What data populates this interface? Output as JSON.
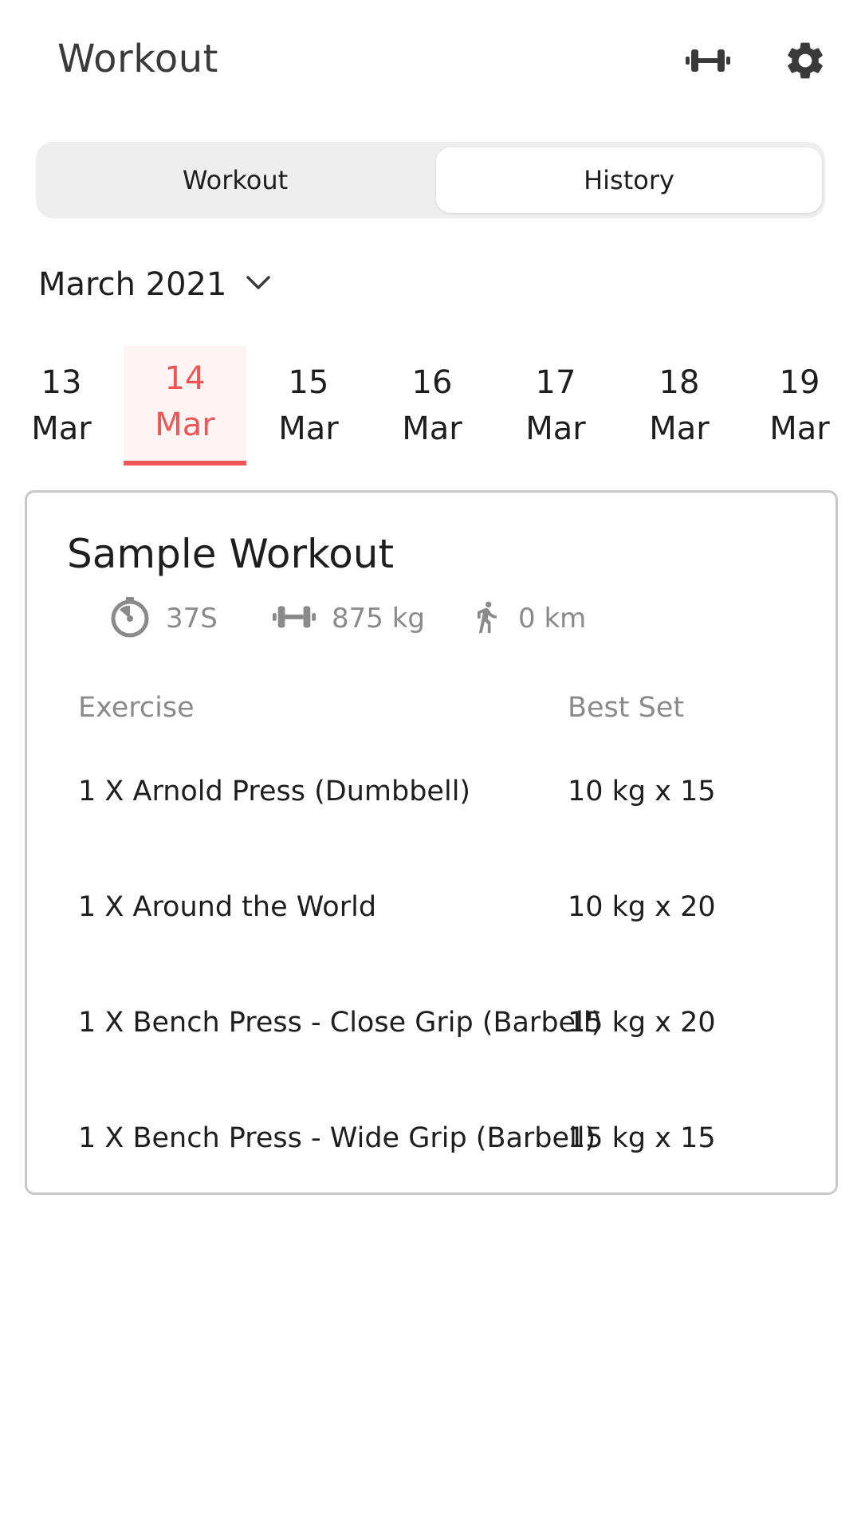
{
  "header": {
    "title": "Workout",
    "icons": [
      "dumbbell-icon",
      "gear-icon"
    ]
  },
  "tabs": [
    {
      "label": "Workout",
      "selected": false
    },
    {
      "label": "History",
      "selected": true
    }
  ],
  "month_selector": {
    "label": "March 2021",
    "icon": "chevron-down-icon"
  },
  "dates": [
    {
      "day": "13",
      "month": "Mar",
      "selected": false
    },
    {
      "day": "14",
      "month": "Mar",
      "selected": true
    },
    {
      "day": "15",
      "month": "Mar",
      "selected": false
    },
    {
      "day": "16",
      "month": "Mar",
      "selected": false
    },
    {
      "day": "17",
      "month": "Mar",
      "selected": false
    },
    {
      "day": "18",
      "month": "Mar",
      "selected": false
    },
    {
      "day": "19",
      "month": "Mar",
      "selected": false
    }
  ],
  "workout_card": {
    "title": "Sample Workout",
    "stats": {
      "duration": "37S",
      "weight": "875 kg",
      "distance": "0 km"
    },
    "columns": {
      "exercise": "Exercise",
      "best_set": "Best Set"
    },
    "exercises": [
      {
        "name": "1 X Arnold Press (Dumbbell)",
        "best_set": "10 kg x 15"
      },
      {
        "name": "1 X Around the World",
        "best_set": "10 kg x 20"
      },
      {
        "name": "1 X Bench Press - Close Grip (Barbell)",
        "best_set": "15 kg x 20"
      },
      {
        "name": "1 X Bench Press - Wide Grip (Barbell)",
        "best_set": "15 kg x 15"
      }
    ]
  },
  "colors": {
    "accent": "#f05454",
    "accent_bg": "#fff4f4",
    "text": "#1e1e1e",
    "muted": "#8a8a8a",
    "segment_bg": "#eeeeee",
    "card_border": "#c8c8c8"
  }
}
